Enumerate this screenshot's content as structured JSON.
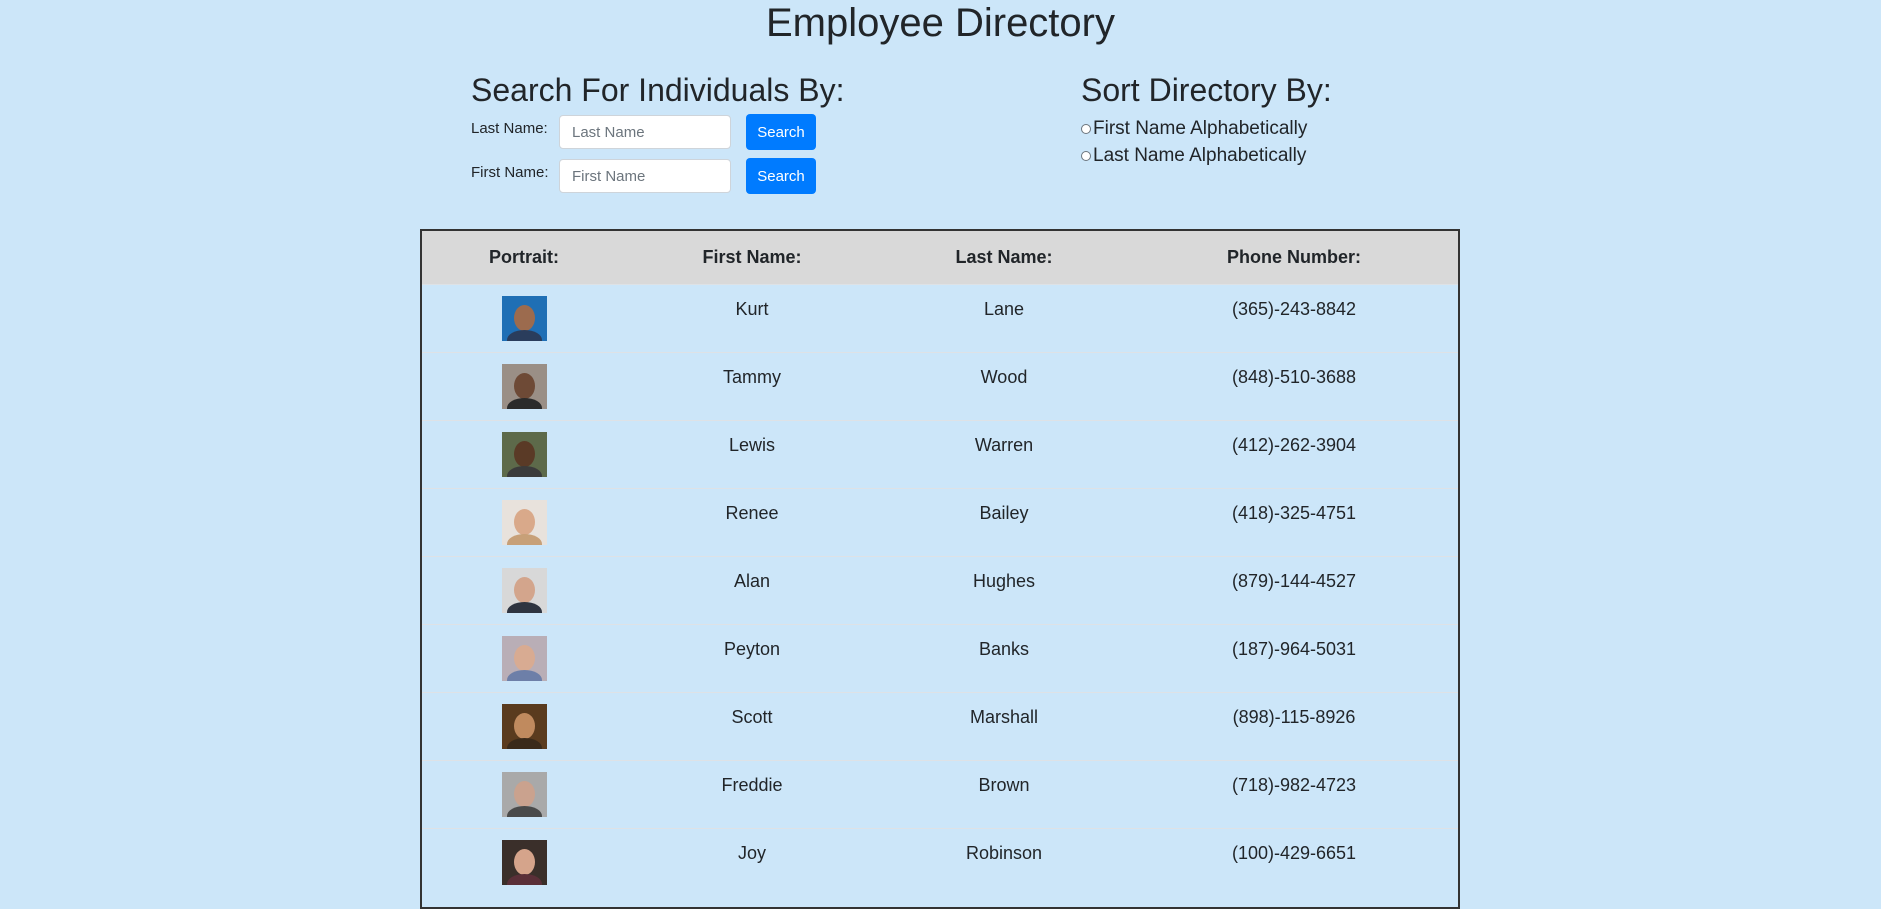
{
  "page": {
    "title": "Employee Directory"
  },
  "search": {
    "title": "Search For Individuals By:",
    "last_name_label": "Last Name:",
    "last_name_placeholder": "Last Name",
    "last_name_value": "",
    "first_name_label": "First Name:",
    "first_name_placeholder": "First Name",
    "first_name_value": "",
    "button_label": "Search"
  },
  "sort": {
    "title": "Sort Directory By:",
    "options": [
      {
        "label": "First Name Alphabetically",
        "selected": false
      },
      {
        "label": "Last Name Alphabetically",
        "selected": false
      }
    ]
  },
  "table": {
    "headers": {
      "portrait": "Portrait:",
      "first_name": "First Name:",
      "last_name": "Last Name:",
      "phone": "Phone Number:"
    },
    "rows": [
      {
        "first": "Kurt",
        "last": "Lane",
        "phone": "(365)-243-8842",
        "bg": "#1f6fb5",
        "skin": "#9c6b4e",
        "shirt": "#2a3d5c"
      },
      {
        "first": "Tammy",
        "last": "Wood",
        "phone": "(848)-510-3688",
        "bg": "#9a8f86",
        "skin": "#6e4a36",
        "shirt": "#2b2b2b"
      },
      {
        "first": "Lewis",
        "last": "Warren",
        "phone": "(412)-262-3904",
        "bg": "#5d6a4a",
        "skin": "#5a3a26",
        "shirt": "#3b3b3b"
      },
      {
        "first": "Renee",
        "last": "Bailey",
        "phone": "(418)-325-4751",
        "bg": "#e8e2dc",
        "skin": "#d9a98a",
        "shirt": "#c7a078"
      },
      {
        "first": "Alan",
        "last": "Hughes",
        "phone": "(879)-144-4527",
        "bg": "#d8d8d8",
        "skin": "#d3a58c",
        "shirt": "#2e3440"
      },
      {
        "first": "Peyton",
        "last": "Banks",
        "phone": "(187)-964-5031",
        "bg": "#b9aeb6",
        "skin": "#d8ab92",
        "shirt": "#6d7fa8"
      },
      {
        "first": "Scott",
        "last": "Marshall",
        "phone": "(898)-115-8926",
        "bg": "#5a3b1e",
        "skin": "#c08a5e",
        "shirt": "#3a2a1a"
      },
      {
        "first": "Freddie",
        "last": "Brown",
        "phone": "(718)-982-4723",
        "bg": "#a9a9a9",
        "skin": "#caa28e",
        "shirt": "#4a4a4a"
      },
      {
        "first": "Joy",
        "last": "Robinson",
        "phone": "(100)-429-6651",
        "bg": "#3a2f2a",
        "skin": "#d5a48b",
        "shirt": "#5a2f38"
      }
    ]
  }
}
